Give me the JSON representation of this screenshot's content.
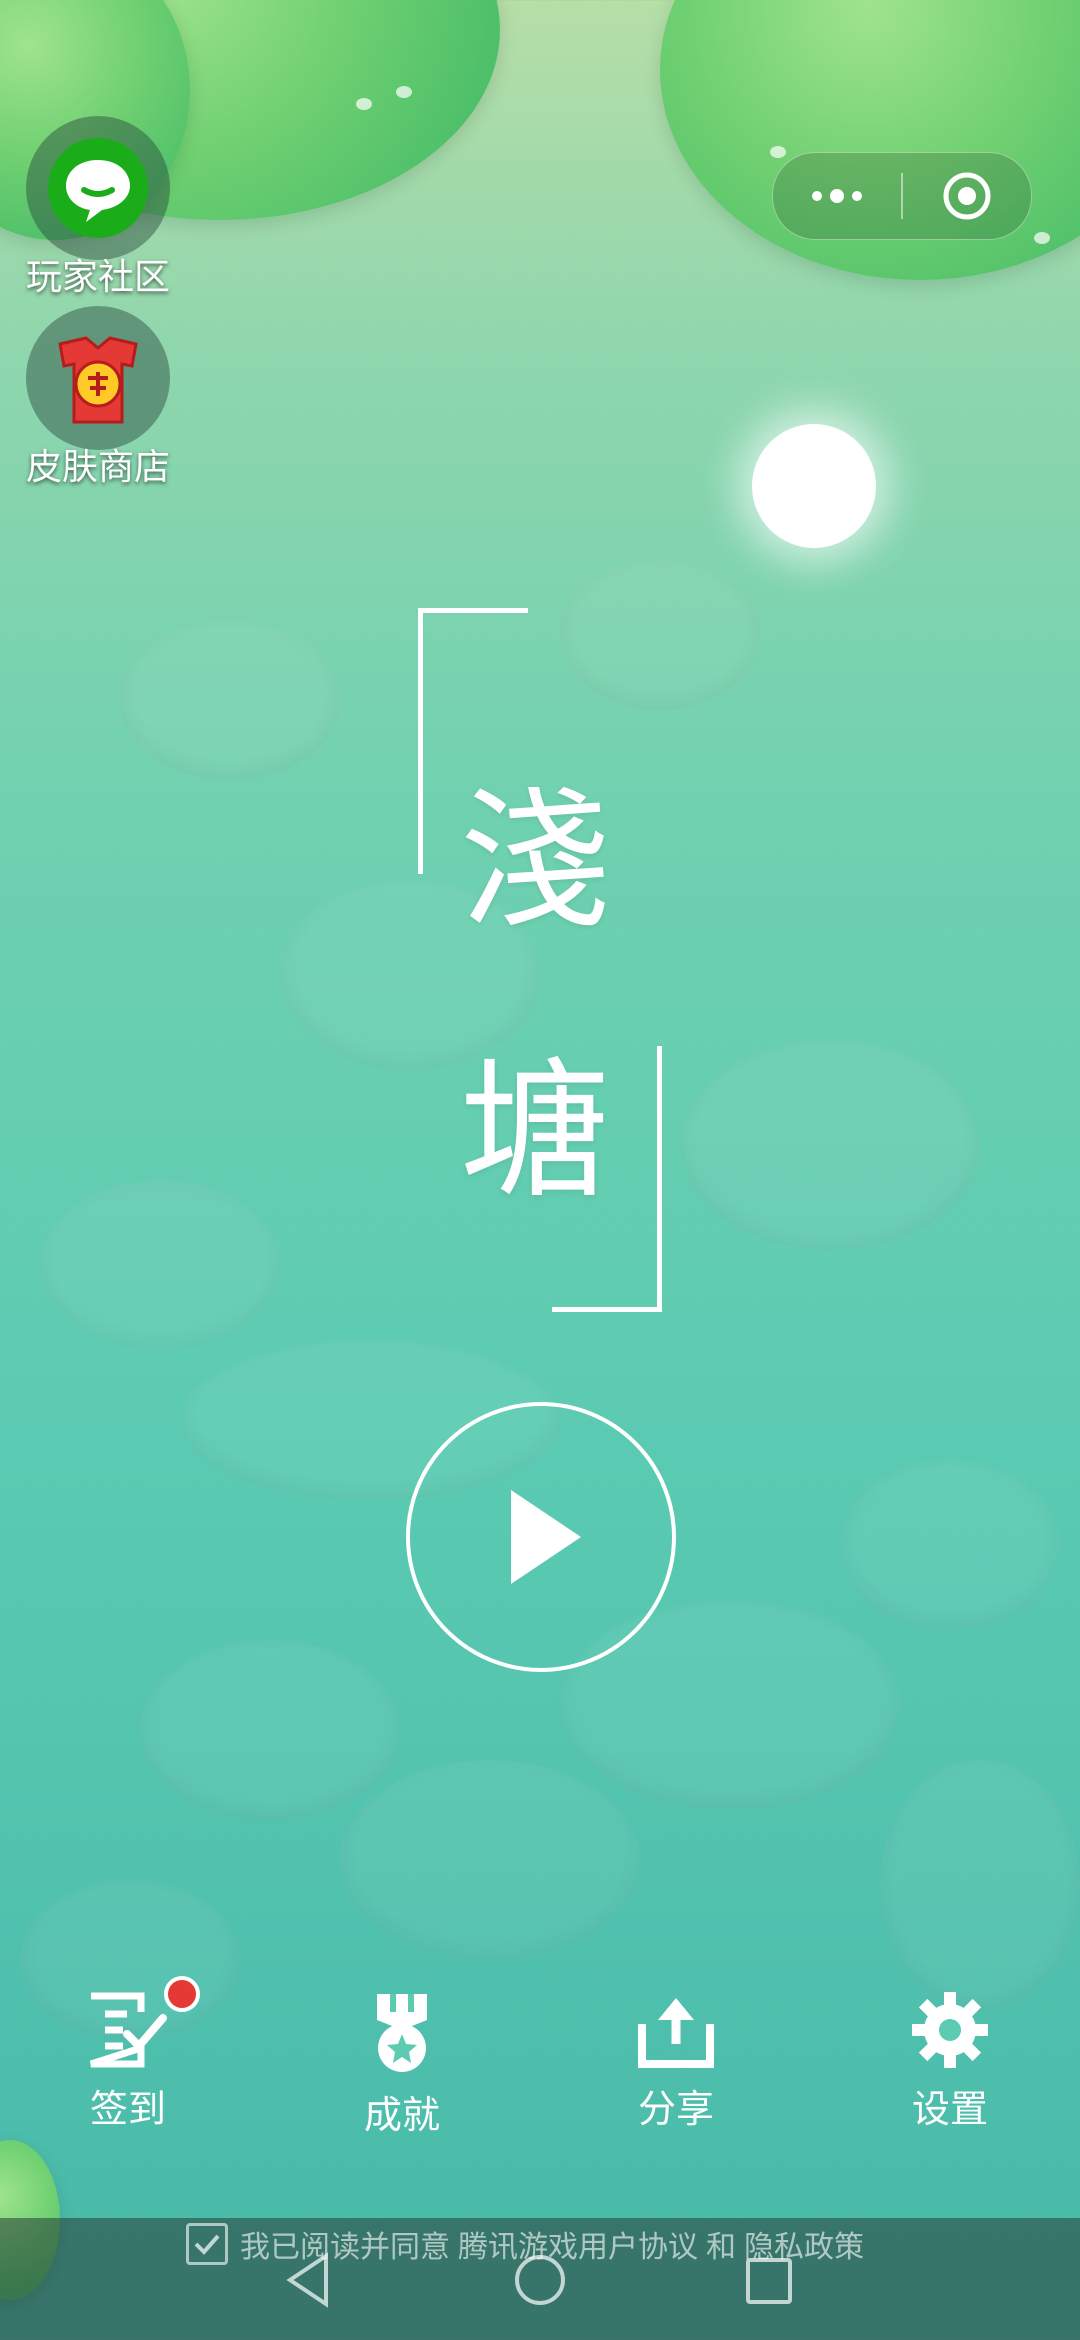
{
  "side_buttons": {
    "community_label": "玩家社区",
    "skin_shop_label": "皮肤商店"
  },
  "capsule": {
    "more_icon": "more-dots-icon",
    "close_icon": "target-circle-icon"
  },
  "title": {
    "char1": "淺",
    "char2": "塘"
  },
  "play_button": {
    "icon": "play-triangle-icon"
  },
  "bottom_nav": [
    {
      "label": "签到",
      "icon": "checkin-icon",
      "has_badge": true
    },
    {
      "label": "成就",
      "icon": "medal-icon"
    },
    {
      "label": "分享",
      "icon": "share-icon"
    },
    {
      "label": "设置",
      "icon": "gear-icon"
    }
  ],
  "agreement": {
    "prefix": "我已阅读并同意",
    "user_agreement": "腾讯游戏用户协议",
    "and": "和",
    "privacy_policy": "隐私政策",
    "checked": true
  },
  "colors": {
    "badge_red": "#e53935",
    "community_green": "#1aad19",
    "shop_red": "#e53935"
  }
}
